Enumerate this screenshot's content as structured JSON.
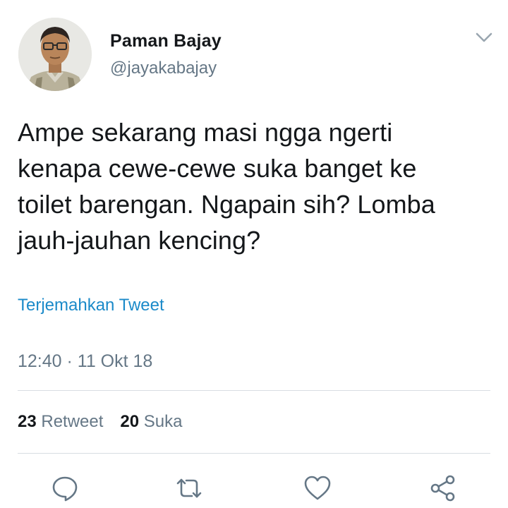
{
  "author": {
    "display_name": "Paman Bajay",
    "handle": "@jayakabajay"
  },
  "tweet": {
    "lines": [
      "Ampe sekarang masi ngga ngerti",
      "kenapa cewe-cewe suka banget ke",
      "toilet barengan. Ngapain sih? Lomba",
      "jauh-jauhan kencing?"
    ],
    "translate_label": "Terjemahkan Tweet",
    "timestamp": "12:40 · 11 Okt 18"
  },
  "stats": {
    "retweets_count": "23",
    "retweets_label": "Retweet",
    "likes_count": "20",
    "likes_label": "Suka"
  },
  "icons": {
    "menu": "chevron-down-icon",
    "reply": "reply-icon",
    "retweet": "retweet-icon",
    "like": "heart-icon",
    "share": "share-icon"
  },
  "colors": {
    "link": "#1b8ac9",
    "secondary_text": "#657786",
    "icon": "#657786",
    "divider": "#d8dde2"
  }
}
